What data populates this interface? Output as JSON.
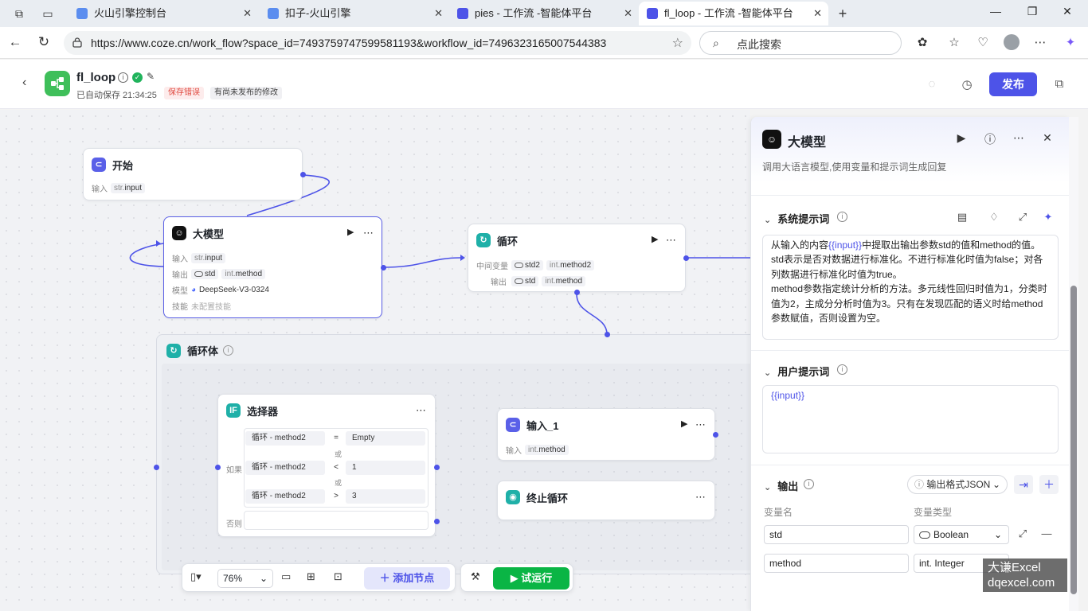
{
  "browser": {
    "tabs": [
      {
        "label": "火山引擎控制台",
        "fav_color": "#5b8def"
      },
      {
        "label": "扣子-火山引擎",
        "fav_color": "#5b8def"
      },
      {
        "label": "pies - 工作流 -智能体平台",
        "fav_color": "#4d53e8"
      },
      {
        "label": "fl_loop - 工作流 -智能体平台",
        "fav_color": "#4d53e8"
      }
    ],
    "url": "https://www.coze.cn/work_flow?space_id=7493759747599581193&workflow_id=7496323165007544383",
    "search_placeholder": "点此搜索"
  },
  "header": {
    "title": "fl_loop",
    "autosave": "已自动保存 21:34:25",
    "save_error": "保存错误",
    "unpublished": "有尚未发布的修改",
    "publish_label": "发布"
  },
  "nodes": {
    "start": {
      "title": "开始",
      "input_label": "输入",
      "input_type": "str.",
      "input_name": "input"
    },
    "llm": {
      "title": "大模型",
      "input_label": "输入",
      "input_type": "str.",
      "input_name": "input",
      "output_label": "输出",
      "out1_name": "std",
      "out2_type": "int.",
      "out2_name": "method",
      "model_label": "模型",
      "model_name": "DeepSeek-V3-0324",
      "skill_label": "技能",
      "skill_value": "未配置技能"
    },
    "loop": {
      "title": "循环",
      "mid_label": "中间变量",
      "mid1_name": "std2",
      "mid2_type": "int.",
      "mid2_name": "method2",
      "out_label": "输出",
      "out1_name": "std",
      "out2_type": "int.",
      "out2_name": "method"
    },
    "loopbody": {
      "title": "循环体"
    },
    "selector": {
      "title": "选择器",
      "if_label": "如果",
      "else_label": "否则",
      "or_label": "或",
      "conditions": [
        {
          "left": "循环  -  method2",
          "op": "=",
          "right": "Empty"
        },
        {
          "left": "循环  -  method2",
          "op": "<",
          "right": "1"
        },
        {
          "left": "循环  -  method2",
          "op": ">",
          "right": "3"
        }
      ]
    },
    "input1": {
      "title": "输入_1",
      "input_label": "输入",
      "input_type": "int.",
      "input_name": "method"
    },
    "break": {
      "title": "终止循环"
    }
  },
  "bottombar": {
    "zoom": "76%",
    "add_node": "添加节点",
    "test_run": "试运行"
  },
  "panel": {
    "title": "大模型",
    "desc": "调用大语言模型,使用变量和提示词生成回复",
    "system_prompt_title": "系统提示词",
    "system_prompt": {
      "p1_before": "从输入的内容",
      "p1_var": "{{input}}",
      "p1_after": "中提取出输出参数std的值和method的值。",
      "p2": "std表示是否对数据进行标准化。不进行标准化时值为false；对各列数据进行标准化时值为true。",
      "p3": "method参数指定统计分析的方法。多元线性回归时值为1，分类时值为2，主成分分析时值为3。只有在发现匹配的语义时给method参数赋值，否则设置为空。"
    },
    "user_prompt_title": "用户提示词",
    "user_prompt": "{{input}}",
    "output_title": "输出",
    "output_format": "输出格式JSON",
    "col_name": "变量名",
    "col_type": "变量类型",
    "outputs": [
      {
        "name": "std",
        "type": "Boolean"
      },
      {
        "name": "method",
        "type": "int. Integer"
      }
    ]
  },
  "watermark": {
    "line1": "大谦Excel",
    "line2": "dqexcel.com"
  }
}
